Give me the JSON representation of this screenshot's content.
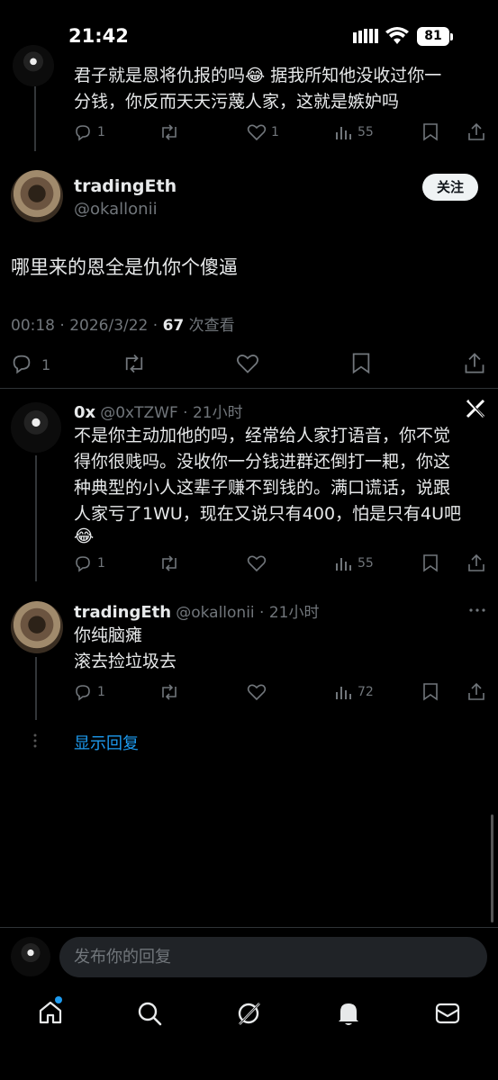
{
  "status_bar": {
    "time": "21:42",
    "battery": "81"
  },
  "top_reply": {
    "text_line1": "君子就是恩将仇报的吗😂 据我所知他没收过你一",
    "text_line2": "分钱，你反而天天污蔑人家，这就是嫉妒吗",
    "replies": "1",
    "likes": "1",
    "views": "55"
  },
  "main_post": {
    "name": "tradingEth",
    "handle": "@okallonii",
    "follow_label": "关注",
    "text": "哪里来的恩全是仇你个傻逼",
    "timestamp": "00:18 · 2026/3/22 · ",
    "views_count": "67",
    "views_label": " 次查看",
    "replies": "1"
  },
  "reply1": {
    "name": "0x",
    "handle_time": "@0xTZWF · 21小时",
    "text_line1": "不是你主动加他的吗，经常给人家打语音，你不觉",
    "text_line2": "得你很贱吗。没收你一分钱进群还倒打一耙，你这",
    "text_line3": "种典型的小人这辈子赚不到钱的。满口谎话，说跟",
    "text_line4": "人家亏了1WU，现在又说只有400，怕是只有4U吧",
    "text_line5": "😂",
    "replies": "1",
    "views": "55"
  },
  "reply2": {
    "name": "tradingEth",
    "handle_time": "@okallonii · 21小时",
    "text_line1": "你纯脑瘫",
    "text_line2": "滚去捡垃圾去",
    "replies": "1",
    "views": "72"
  },
  "show_replies": "显示回复",
  "reply_bar": {
    "placeholder": "发布你的回复"
  },
  "colors": {
    "accent": "#1d9bf0",
    "background": "#000000",
    "muted": "#71767b"
  }
}
